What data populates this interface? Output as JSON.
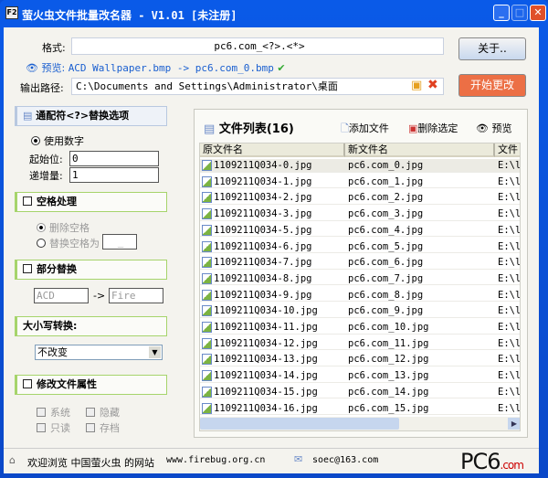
{
  "window": {
    "title": "萤火虫文件批量改名器 - V1.01  [未注册]",
    "icon": "F2"
  },
  "top": {
    "format_label": "格式:",
    "format_value": "pc6.com_<?>.<*>",
    "preview_label": "预览:",
    "preview_text": "ACD Wallpaper.bmp -> pc6.com_0.bmp",
    "output_label": "输出路径:",
    "output_value": "C:\\Documents and Settings\\Administrator\\桌面",
    "about_button": "关于..",
    "start_button": "开始更改"
  },
  "left": {
    "wildcard_title": "通配符<?>替换选项",
    "use_number": "使用数字",
    "start_label": "起始位:",
    "start_value": "0",
    "step_label": "递增量:",
    "step_value": "1",
    "space_title": "空格处理",
    "delete_space": "删除空格",
    "replace_space": "替换空格为",
    "replace_space_value": "_",
    "partial_title": "部分替换",
    "partial_from": "ACD",
    "partial_arrow": "->",
    "partial_to": "Fire",
    "case_title": "大小写转换:",
    "case_value": "不改变",
    "attr_title": "修改文件属性",
    "attrs": [
      "系统",
      "隐藏",
      "只读",
      "存档"
    ]
  },
  "list": {
    "title": "文件列表(16)",
    "add_file": "添加文件",
    "delete_selected": "删除选定",
    "preview": "预览",
    "columns": [
      "原文件名",
      "新文件名",
      "文件"
    ],
    "rows": [
      [
        "1109211Q034-0.jpg",
        "pc6.com_0.jpg",
        "E:\\l"
      ],
      [
        "1109211Q034-1.jpg",
        "pc6.com_1.jpg",
        "E:\\l"
      ],
      [
        "1109211Q034-2.jpg",
        "pc6.com_2.jpg",
        "E:\\l"
      ],
      [
        "1109211Q034-3.jpg",
        "pc6.com_3.jpg",
        "E:\\l"
      ],
      [
        "1109211Q034-5.jpg",
        "pc6.com_4.jpg",
        "E:\\l"
      ],
      [
        "1109211Q034-6.jpg",
        "pc6.com_5.jpg",
        "E:\\l"
      ],
      [
        "1109211Q034-7.jpg",
        "pc6.com_6.jpg",
        "E:\\l"
      ],
      [
        "1109211Q034-8.jpg",
        "pc6.com_7.jpg",
        "E:\\l"
      ],
      [
        "1109211Q034-9.jpg",
        "pc6.com_8.jpg",
        "E:\\l"
      ],
      [
        "1109211Q034-10.jpg",
        "pc6.com_9.jpg",
        "E:\\l"
      ],
      [
        "1109211Q034-11.jpg",
        "pc6.com_10.jpg",
        "E:\\l"
      ],
      [
        "1109211Q034-12.jpg",
        "pc6.com_11.jpg",
        "E:\\l"
      ],
      [
        "1109211Q034-13.jpg",
        "pc6.com_12.jpg",
        "E:\\l"
      ],
      [
        "1109211Q034-14.jpg",
        "pc6.com_13.jpg",
        "E:\\l"
      ],
      [
        "1109211Q034-15.jpg",
        "pc6.com_14.jpg",
        "E:\\l"
      ],
      [
        "1109211Q034-16.jpg",
        "pc6.com_15.jpg",
        "E:\\l"
      ]
    ]
  },
  "status": {
    "welcome": "欢迎浏览 中国萤火虫 的网站",
    "website": "www.firebug.org.cn",
    "email": "soec@163.com",
    "watermark": "PC6下载.com"
  }
}
